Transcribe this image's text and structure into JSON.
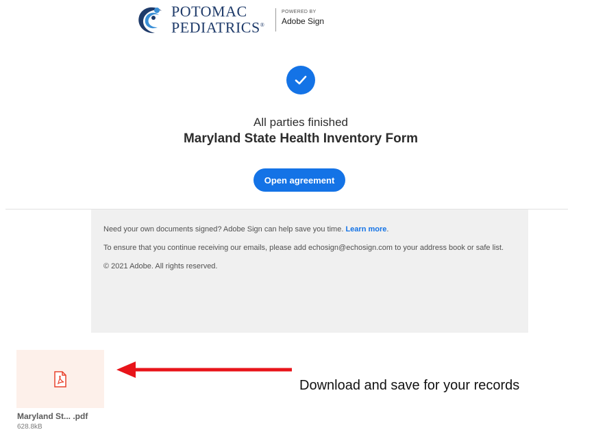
{
  "header": {
    "brand_line1": "POTOMAC",
    "brand_line2": "PEDIATRICS",
    "brand_mark": "®",
    "powered_by": "POWERED BY",
    "powered_product": "Adobe Sign",
    "logo_icon": "potomac-pediatrics-logo"
  },
  "main": {
    "status_icon": "check-circle-icon",
    "status_text": "All parties finished",
    "document_title": "Maryland State Health Inventory Form",
    "open_button": "Open agreement"
  },
  "footer": {
    "line1_text": "Need your own documents signed? Adobe Sign can help save you time.",
    "line1_link": "Learn more",
    "line1_end": ".",
    "line2": "To ensure that you continue receiving our emails, please add echosign@echosign.com to your address book or safe list.",
    "line3": "© 2021 Adobe. All rights reserved."
  },
  "attachment": {
    "icon": "pdf-file-icon",
    "name": "Maryland St... .pdf",
    "size": "628.8kB"
  },
  "annotation": {
    "arrow_icon": "left-arrow-icon",
    "arrow_color": "#e8141a",
    "text": "Download and save for your records"
  },
  "colors": {
    "accent": "#1473e6",
    "brand_navy": "#1f3b6a",
    "footer_bg": "#f0f0f0"
  }
}
